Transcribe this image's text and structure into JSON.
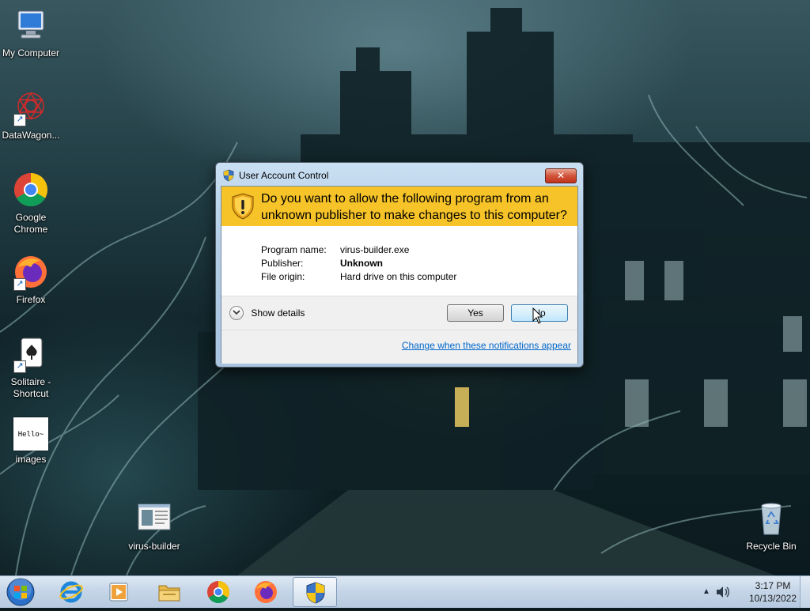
{
  "desktop": {
    "icons": [
      {
        "label": "My Computer",
        "icon": "computer-icon"
      },
      {
        "label": "DataWagon...",
        "icon": "datawagon-icon"
      },
      {
        "label": "Google Chrome",
        "icon": "chrome-icon"
      },
      {
        "label": "Firefox",
        "icon": "firefox-icon"
      },
      {
        "label": "Solitaire - Shortcut",
        "icon": "solitaire-icon"
      },
      {
        "label": "images",
        "icon": "image-file-icon",
        "preview_text": "Hello~"
      },
      {
        "label": "virus-builder",
        "icon": "application-icon"
      },
      {
        "label": "Recycle Bin",
        "icon": "recycle-bin-icon"
      }
    ]
  },
  "uac": {
    "title": "User Account Control",
    "close_label": "✕",
    "question": "Do you want to allow the following program from an unknown publisher to make changes to this computer?",
    "info": [
      {
        "label": "Program name:",
        "value": "virus-builder.exe"
      },
      {
        "label": "Publisher:",
        "value": "Unknown"
      },
      {
        "label": "File origin:",
        "value": "Hard drive on this computer"
      }
    ],
    "show_details": "Show details",
    "yes_label": "Yes",
    "no_label": "No",
    "change_link": "Change when these notifications appear",
    "colors": {
      "banner": "#f6c328",
      "link": "#0066cc"
    }
  },
  "taskbar": {
    "pinned": [
      "internet-explorer-icon",
      "media-player-icon",
      "file-explorer-icon",
      "chrome-icon",
      "firefox-icon",
      "uac-shield-icon"
    ],
    "active": "uac-shield-icon",
    "clock": {
      "time": "3:17 PM",
      "date": "10/13/2022"
    }
  }
}
